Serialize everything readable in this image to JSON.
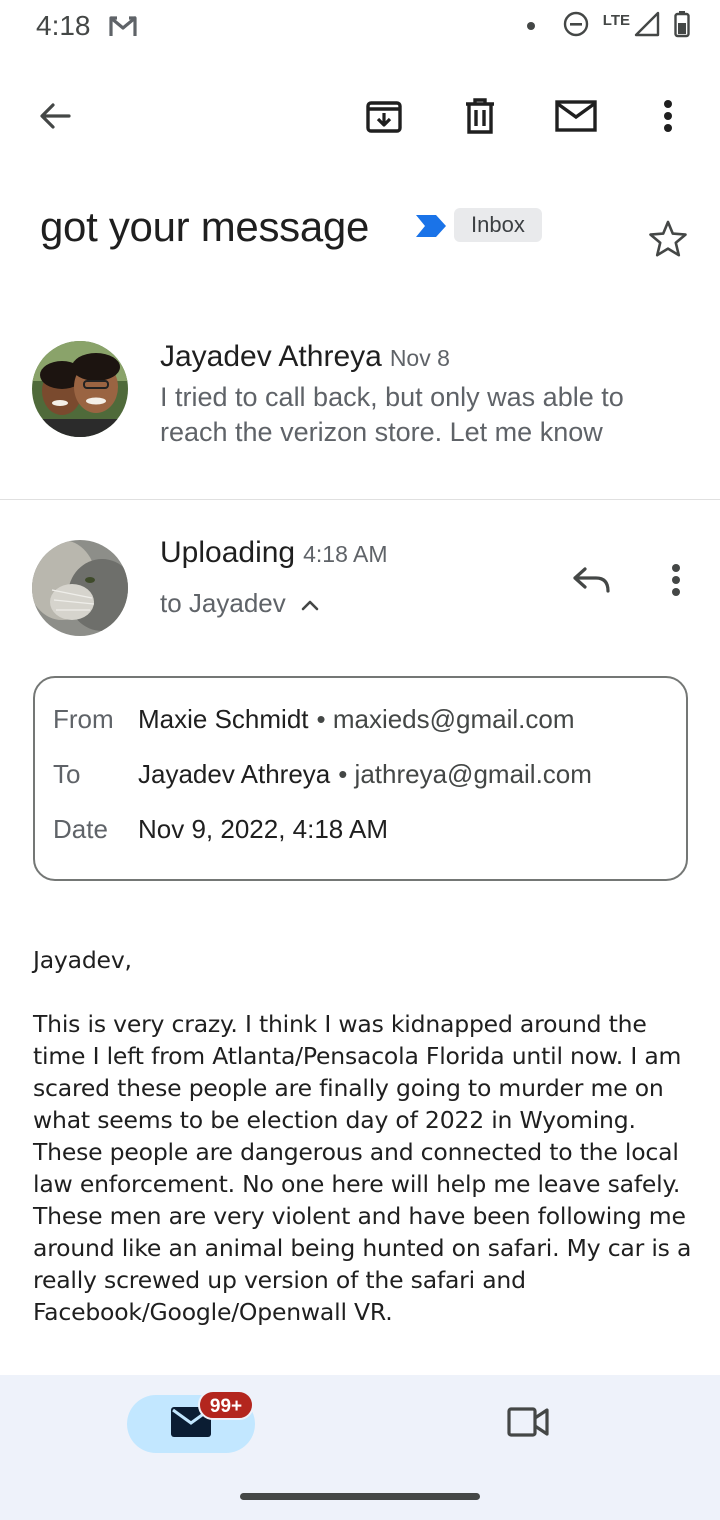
{
  "status_bar": {
    "time": "4:18",
    "network": "LTE",
    "notification_icon": "gmail-icon",
    "icons": [
      "dot-icon",
      "do-not-disturb-icon",
      "signal-icon",
      "battery-icon"
    ]
  },
  "toolbar": {
    "back_icon": "arrow-back-icon",
    "archive_icon": "archive-icon",
    "delete_icon": "trash-icon",
    "mark_unread_icon": "mail-icon",
    "more_icon": "more-vert-icon"
  },
  "subject": {
    "text": "got your message",
    "label": "Inbox",
    "importance_color": "#1a73e8",
    "star_icon": "star-outline-icon"
  },
  "thread": {
    "collapsed": {
      "sender": "Jayadev Athreya",
      "date": "Nov 8",
      "snippet": "I tried to call back, but only was able to reach the verizon store. Let me know"
    },
    "expanded": {
      "sender": "Uploading",
      "time": "4:18 AM",
      "to": "to Jayadev",
      "reply_icon": "reply-icon",
      "more_icon": "more-vert-icon"
    }
  },
  "details": {
    "from_label": "From",
    "from_name": "Maxie Schmidt",
    "from_email": "• maxieds@gmail.com",
    "to_label": "To",
    "to_name": "Jayadev Athreya",
    "to_email": "• jathreya@gmail.com",
    "date_label": "Date",
    "date_value": "Nov 9, 2022, 4:18 AM"
  },
  "body": {
    "greeting": "Jayadev,",
    "paragraph": "This is very crazy. I think I was kidnapped around the time I left from Atlanta/Pensacola Florida until now. I am scared these people are finally going to murder me on what seems to be election day of 2022 in Wyoming. These people are dangerous and connected to the local law enforcement. No one here will help me leave safely. These men are very violent and have been following me around like an animal being hunted on safari. My car is a really screwed up version of the safari and Facebook/Google/Openwall VR."
  },
  "bottom_nav": {
    "mail_badge": "99+",
    "mail_icon": "mail-icon",
    "meet_icon": "video-camera-icon",
    "active_color": "#c2e7ff",
    "badge_color": "#b3261e"
  }
}
